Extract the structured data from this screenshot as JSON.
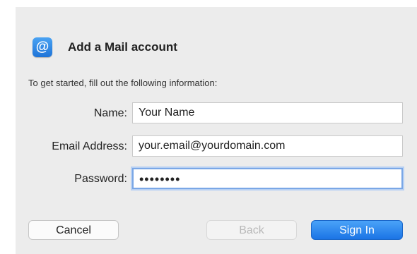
{
  "dialog": {
    "title": "Add a Mail account",
    "icon": "at-sign-icon",
    "icon_glyph": "@",
    "intro": "To get started, fill out the following information:"
  },
  "fields": {
    "name": {
      "label": "Name:",
      "value": "Your Name"
    },
    "email": {
      "label": "Email Address:",
      "value": "your.email@yourdomain.com"
    },
    "password": {
      "label": "Password:",
      "value": "••••••••"
    }
  },
  "buttons": {
    "cancel": "Cancel",
    "back": "Back",
    "sign_in": "Sign In"
  },
  "colors": {
    "accent": "#1b74e5",
    "dialog_bg": "#ececec"
  }
}
